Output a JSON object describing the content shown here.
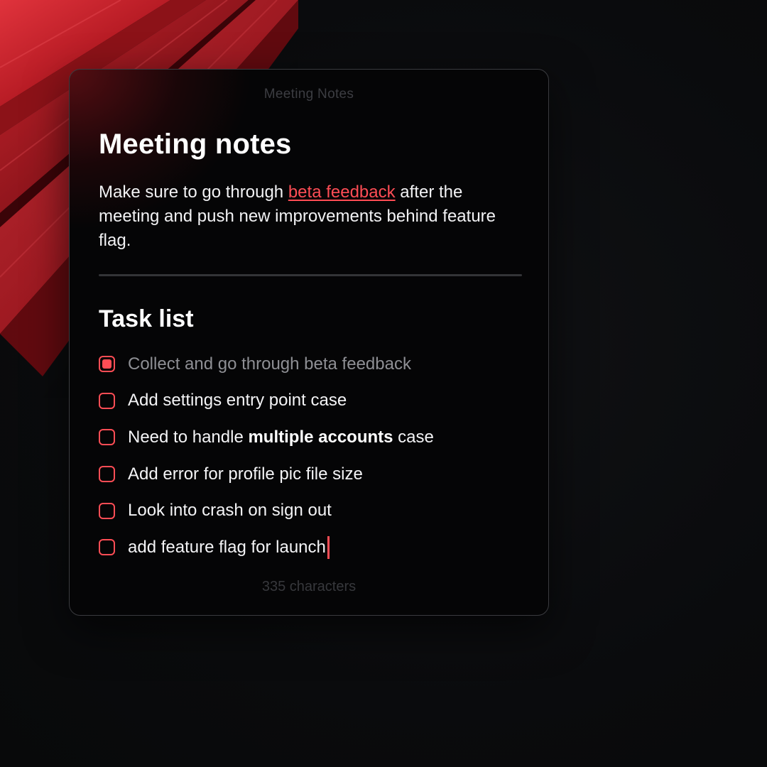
{
  "window": {
    "title": "Meeting Notes"
  },
  "document": {
    "heading": "Meeting notes",
    "paragraph": {
      "before_link": "Make sure to go through ",
      "link_text": "beta feedback",
      "after_link": " after the meeting and push new improvements behind feature flag."
    },
    "task_heading": "Task list",
    "tasks": [
      {
        "checked": true,
        "text": "Collect and go through beta feedback"
      },
      {
        "checked": false,
        "text": "Add settings entry point case"
      },
      {
        "checked": false,
        "text_before": "Need to handle ",
        "text_bold": "multiple accounts",
        "text_after": " case"
      },
      {
        "checked": false,
        "text": "Add error for profile pic file size"
      },
      {
        "checked": false,
        "text": "Look into crash on sign out"
      },
      {
        "checked": false,
        "text": "add feature flag for launch"
      }
    ]
  },
  "footer": {
    "char_count": "335 characters"
  },
  "colors": {
    "accent": "#ff4d55",
    "background": "#0b0c0e",
    "window": "#050506"
  }
}
